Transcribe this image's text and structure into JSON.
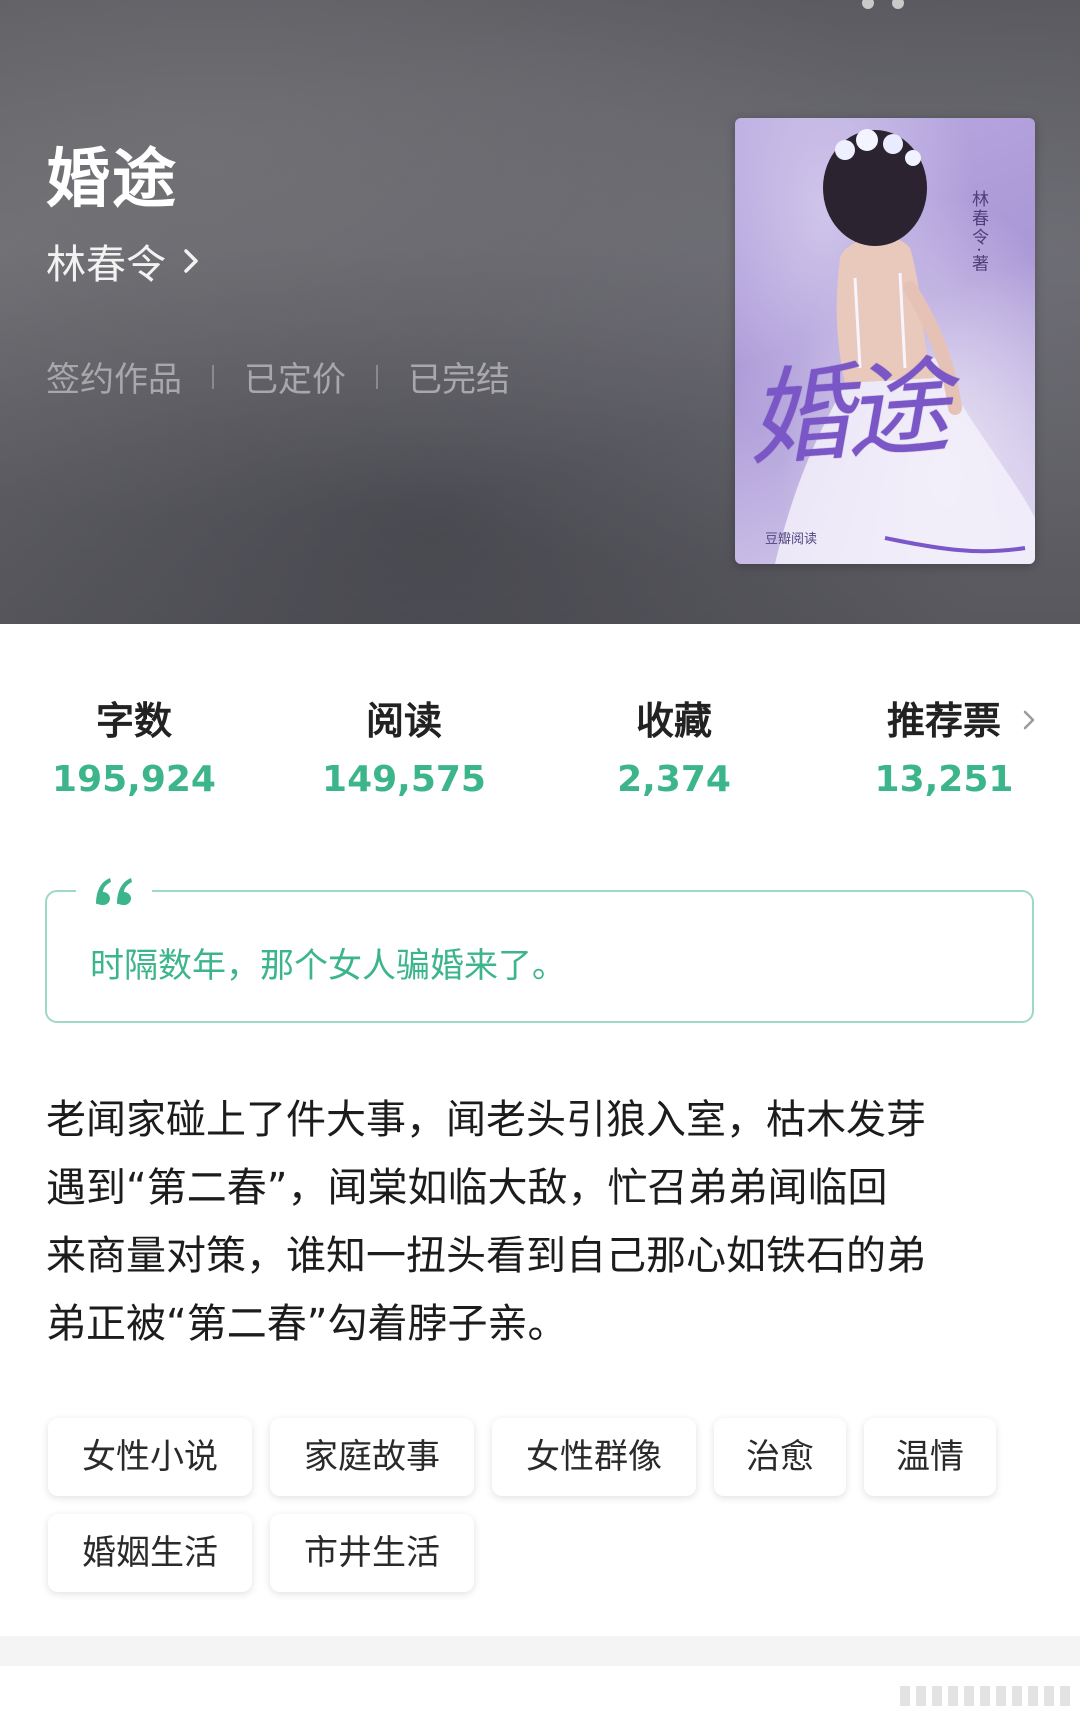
{
  "book": {
    "title": "婚途",
    "author": "林春令",
    "badges": [
      "签约作品",
      "已定价",
      "已完结"
    ]
  },
  "cover": {
    "title": "婚途",
    "author_line": "林春令·著",
    "publisher": "豆瓣阅读"
  },
  "stats": [
    {
      "label": "字数",
      "value": "195,924"
    },
    {
      "label": "阅读",
      "value": "149,575"
    },
    {
      "label": "收藏",
      "value": "2,374"
    },
    {
      "label": "推荐票",
      "value": "13,251"
    }
  ],
  "quote": "时隔数年，那个女人骗婚来了。",
  "description_lines": [
    "老闻家碰上了件大事，闻老头引狼入室，枯木发芽",
    "遇到“第二春”，闻棠如临大敌，忙召弟弟闻临回",
    "来商量对策，谁知一扭头看到自己那心如铁石的弟",
    "弟正被“第二春”勾着脖子亲。"
  ],
  "tags": [
    "女性小说",
    "家庭故事",
    "女性群像",
    "治愈",
    "温情",
    "婚姻生活",
    "市井生活"
  ],
  "colors": {
    "accent": "#3db58b",
    "quote_border": "#9ed9c3",
    "header_bg": "#5e5e64"
  },
  "icons": {
    "author_chevron": "chevron-right-icon",
    "stats_more": "chevron-right-icon",
    "quote": "quote-icon"
  }
}
